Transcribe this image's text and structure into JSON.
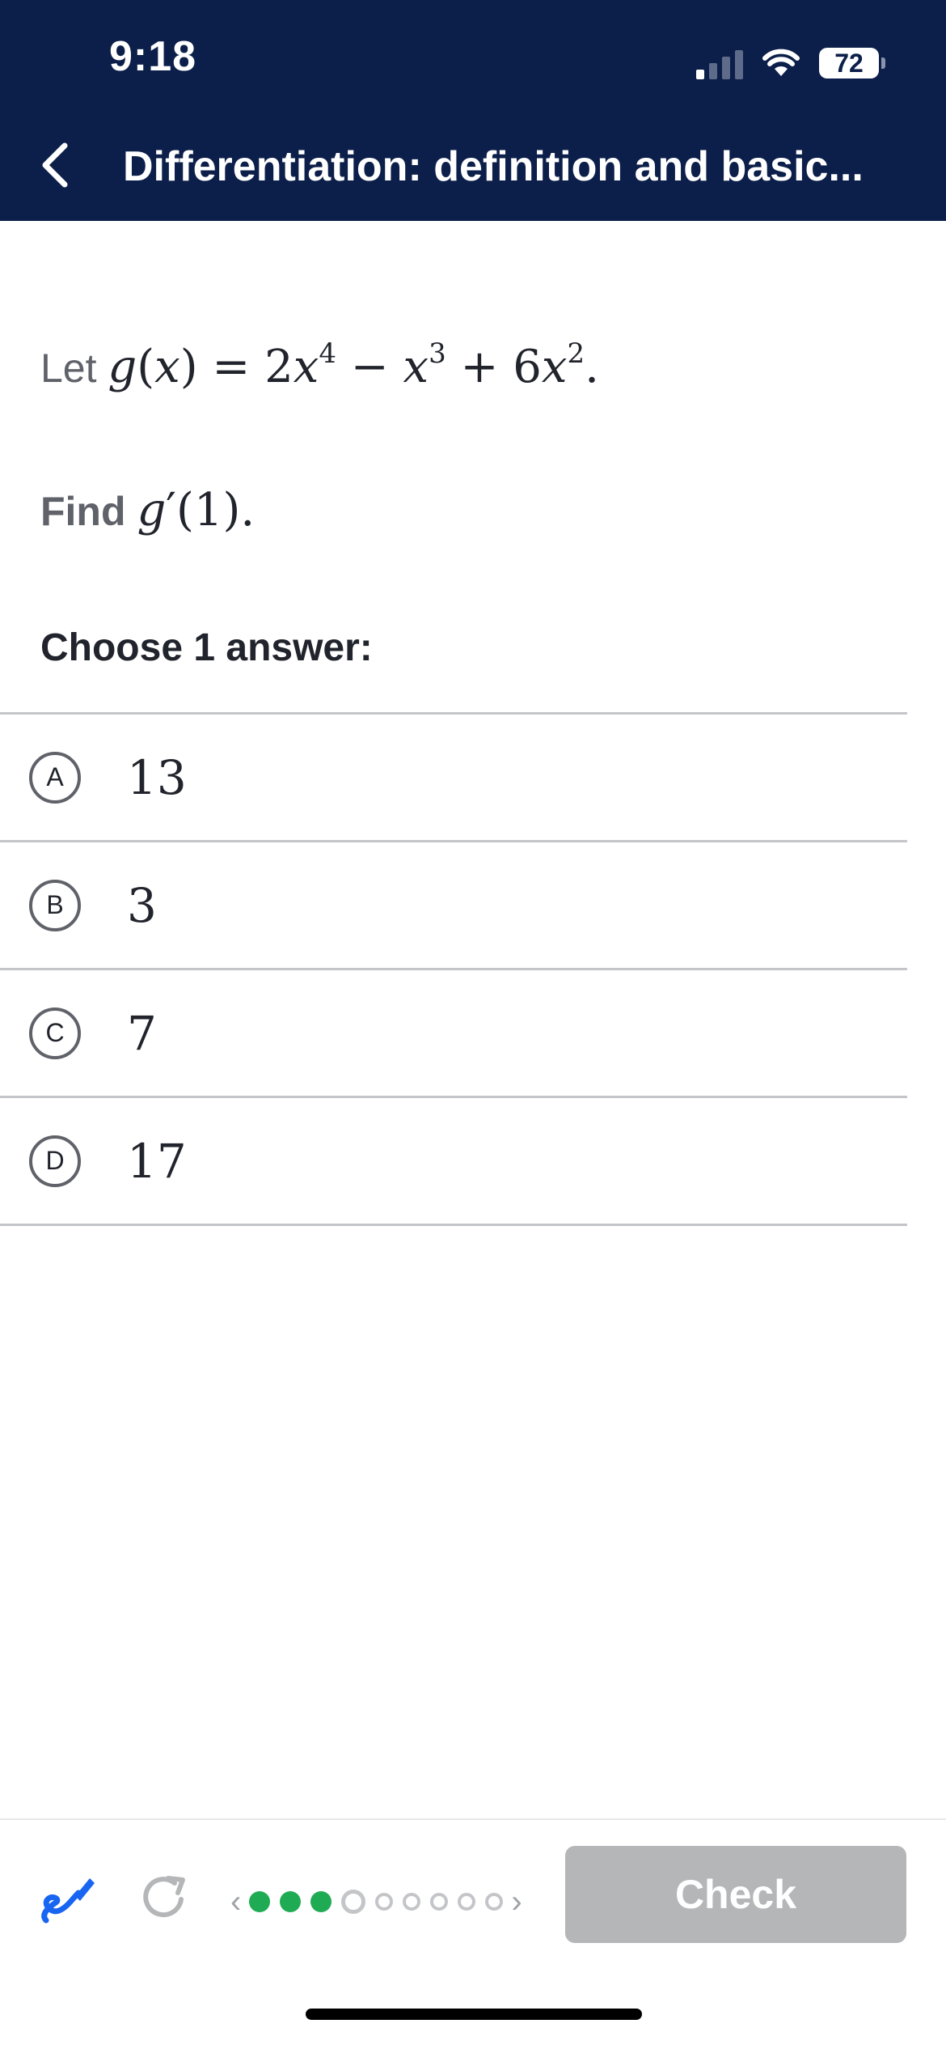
{
  "status_bar": {
    "time": "9:18",
    "battery": "72"
  },
  "header": {
    "title": "Differentiation: definition and basic..."
  },
  "question": {
    "intro": "Let",
    "prompt": "Find"
  },
  "choose_label": "Choose 1 answer:",
  "choices": [
    {
      "letter": "A",
      "value": "13"
    },
    {
      "letter": "B",
      "value": "3"
    },
    {
      "letter": "C",
      "value": "7"
    },
    {
      "letter": "D",
      "value": "17"
    }
  ],
  "bottom_bar": {
    "check_label": "Check",
    "progress": {
      "completed": 3,
      "current": 4,
      "total": 9
    }
  },
  "colors": {
    "header_bg": "#0c1f4a",
    "progress_done": "#1fab54",
    "check_disabled": "#b5b6b8",
    "pencil": "#1865f2"
  }
}
